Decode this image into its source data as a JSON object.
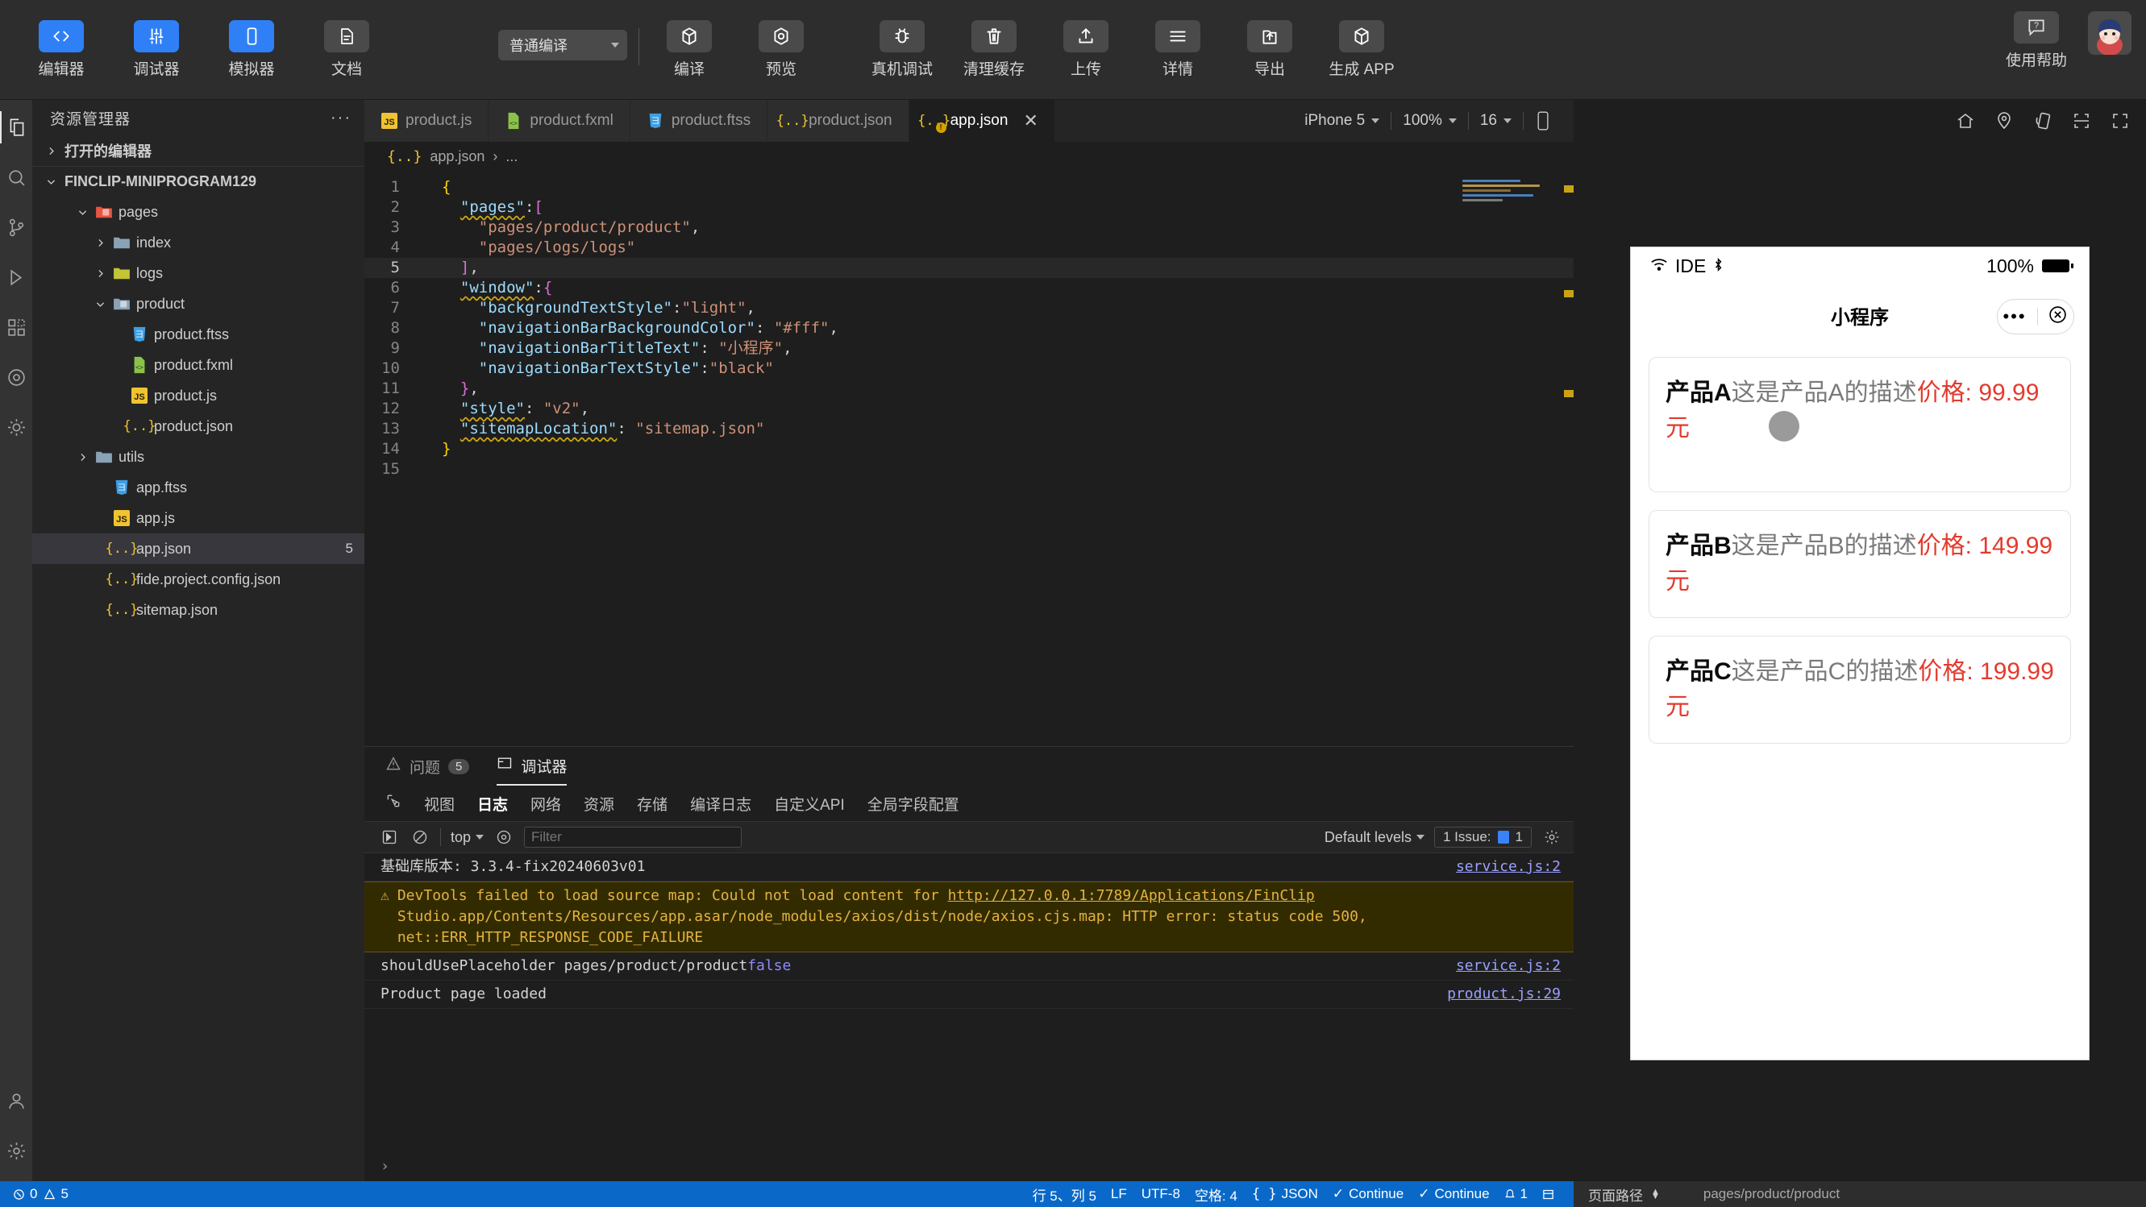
{
  "toolbar": {
    "left_buttons": [
      {
        "label": "编辑器",
        "icon": "code-icon",
        "active": true
      },
      {
        "label": "调试器",
        "icon": "sliders-icon",
        "active": true
      },
      {
        "label": "模拟器",
        "icon": "phone-icon",
        "active": true
      },
      {
        "label": "文档",
        "icon": "document-icon",
        "active": false
      }
    ],
    "compile_mode": "普通编译",
    "center_buttons": [
      {
        "label": "编译",
        "icon": "compile-cube-icon"
      },
      {
        "label": "预览",
        "icon": "preview-eye-icon"
      },
      {
        "label": "真机调试",
        "icon": "bug-icon"
      },
      {
        "label": "清理缓存",
        "icon": "trash-icon"
      },
      {
        "label": "上传",
        "icon": "upload-icon"
      },
      {
        "label": "详情",
        "icon": "hamburger-icon"
      },
      {
        "label": "导出",
        "icon": "export-folder-icon"
      },
      {
        "label": "生成 APP",
        "icon": "generate-cube-icon"
      }
    ],
    "help_label": "使用帮助",
    "help_icon": "question-bubble-icon",
    "avatar": "user-avatar"
  },
  "activitybar": {
    "items": [
      {
        "name": "explorer",
        "icon": "files-icon",
        "selected": true
      },
      {
        "name": "search",
        "icon": "search-icon",
        "selected": false
      },
      {
        "name": "source-control",
        "icon": "branch-icon",
        "selected": false
      },
      {
        "name": "run-debug",
        "icon": "play-debug-icon",
        "selected": false
      },
      {
        "name": "extensions",
        "icon": "extensions-icon",
        "selected": false
      },
      {
        "name": "cloud",
        "icon": "donut-icon",
        "selected": false
      },
      {
        "name": "theme",
        "icon": "sun-icon",
        "selected": false
      },
      {
        "name": "account",
        "icon": "person-icon",
        "selected": false
      },
      {
        "name": "settings",
        "icon": "gear-icon",
        "selected": false
      }
    ]
  },
  "explorer": {
    "title": "资源管理器",
    "more_label": "···",
    "open_editors_label": "打开的编辑器",
    "root_label": "FINCLIP-MINIPROGRAM129",
    "tree": [
      {
        "label": "pages",
        "indent": 1,
        "type": "folder-open",
        "color": "#e8543f",
        "expanded": true,
        "arrow": "down",
        "badge": ""
      },
      {
        "label": "index",
        "indent": 2,
        "type": "folder",
        "color": "#8aa2b5",
        "expanded": false,
        "arrow": "right",
        "badge": ""
      },
      {
        "label": "logs",
        "indent": 2,
        "type": "folder",
        "color": "#c3c436",
        "expanded": false,
        "arrow": "right",
        "badge": ""
      },
      {
        "label": "product",
        "indent": 2,
        "type": "folder-open",
        "color": "#8aa2b5",
        "expanded": true,
        "arrow": "down",
        "badge": ""
      },
      {
        "label": "product.ftss",
        "indent": 3,
        "type": "css",
        "color": "#3c9ee5",
        "arrow": "",
        "badge": ""
      },
      {
        "label": "product.fxml",
        "indent": 3,
        "type": "xml",
        "color": "#8bc34a",
        "arrow": "",
        "badge": ""
      },
      {
        "label": "product.js",
        "indent": 3,
        "type": "js",
        "color": "#f0c330",
        "arrow": "",
        "badge": ""
      },
      {
        "label": "product.json",
        "indent": 3,
        "type": "json",
        "color": "#f0c330",
        "arrow": "",
        "badge": ""
      },
      {
        "label": "utils",
        "indent": 1,
        "type": "folder",
        "color": "#8aa2b5",
        "expanded": false,
        "arrow": "right",
        "badge": ""
      },
      {
        "label": "app.ftss",
        "indent": 2,
        "type": "css",
        "color": "#3c9ee5",
        "arrow": "",
        "badge": ""
      },
      {
        "label": "app.js",
        "indent": 2,
        "type": "js",
        "color": "#f0c330",
        "arrow": "",
        "badge": ""
      },
      {
        "label": "app.json",
        "indent": 2,
        "type": "json",
        "color": "#f0c330",
        "arrow": "",
        "badge": "5",
        "selected": true
      },
      {
        "label": "fide.project.config.json",
        "indent": 2,
        "type": "json",
        "color": "#f0c330",
        "arrow": "",
        "badge": ""
      },
      {
        "label": "sitemap.json",
        "indent": 2,
        "type": "json",
        "color": "#f0c330",
        "arrow": "",
        "badge": ""
      }
    ]
  },
  "editor": {
    "tabs": [
      {
        "label": "product.js",
        "icon": "js",
        "color": "#f0c330",
        "active": false,
        "warn": false
      },
      {
        "label": "product.fxml",
        "icon": "xml",
        "color": "#8bc34a",
        "active": false,
        "warn": false
      },
      {
        "label": "product.ftss",
        "icon": "css",
        "color": "#3c9ee5",
        "active": false,
        "warn": false
      },
      {
        "label": "product.json",
        "icon": "json",
        "color": "#f0c330",
        "active": false,
        "warn": false
      },
      {
        "label": "app.json",
        "icon": "json",
        "color": "#f0c330",
        "active": true,
        "warn": true,
        "close": "✕"
      }
    ],
    "sim_controls": {
      "device": "iPhone 5",
      "zoom": "100%",
      "font_size": "16",
      "rotate_icon": "rotate-device-icon"
    },
    "breadcrumb": {
      "file": "app.json",
      "sep": "›",
      "rest": "..."
    },
    "code_lines": [
      {
        "n": "1",
        "current": false,
        "tokens": [
          {
            "t": "{",
            "c": "k-br1"
          }
        ]
      },
      {
        "n": "2",
        "current": false,
        "tokens": [
          {
            "t": "  ",
            "c": "k-pun"
          },
          {
            "t": "\"pages\"",
            "c": "k-key2"
          },
          {
            "t": ":",
            "c": "k-pun"
          },
          {
            "t": "[",
            "c": "k-br2"
          }
        ]
      },
      {
        "n": "3",
        "current": false,
        "tokens": [
          {
            "t": "    ",
            "c": "k-pun"
          },
          {
            "t": "\"pages/product/product\"",
            "c": "k-str"
          },
          {
            "t": ",",
            "c": "k-pun"
          }
        ]
      },
      {
        "n": "4",
        "current": false,
        "tokens": [
          {
            "t": "    ",
            "c": "k-pun"
          },
          {
            "t": "\"pages/logs/logs\"",
            "c": "k-str"
          }
        ]
      },
      {
        "n": "5",
        "current": true,
        "tokens": [
          {
            "t": "  ",
            "c": "k-pun"
          },
          {
            "t": "]",
            "c": "k-br2"
          },
          {
            "t": ",",
            "c": "k-pun"
          }
        ]
      },
      {
        "n": "6",
        "current": false,
        "tokens": [
          {
            "t": "  ",
            "c": "k-pun"
          },
          {
            "t": "\"window\"",
            "c": "k-key2"
          },
          {
            "t": ":",
            "c": "k-pun"
          },
          {
            "t": "{",
            "c": "k-br2"
          }
        ]
      },
      {
        "n": "7",
        "current": false,
        "tokens": [
          {
            "t": "    ",
            "c": "k-pun"
          },
          {
            "t": "\"backgroundTextStyle\"",
            "c": "k-key"
          },
          {
            "t": ":",
            "c": "k-pun"
          },
          {
            "t": "\"light\"",
            "c": "k-str"
          },
          {
            "t": ",",
            "c": "k-pun"
          }
        ]
      },
      {
        "n": "8",
        "current": false,
        "tokens": [
          {
            "t": "    ",
            "c": "k-pun"
          },
          {
            "t": "\"navigationBarBackgroundColor\"",
            "c": "k-key"
          },
          {
            "t": ": ",
            "c": "k-pun"
          },
          {
            "t": "\"#fff\"",
            "c": "k-str"
          },
          {
            "t": ",",
            "c": "k-pun"
          }
        ]
      },
      {
        "n": "9",
        "current": false,
        "tokens": [
          {
            "t": "    ",
            "c": "k-pun"
          },
          {
            "t": "\"navigationBarTitleText\"",
            "c": "k-key"
          },
          {
            "t": ": ",
            "c": "k-pun"
          },
          {
            "t": "\"小程序\"",
            "c": "k-str"
          },
          {
            "t": ",",
            "c": "k-pun"
          }
        ]
      },
      {
        "n": "10",
        "current": false,
        "tokens": [
          {
            "t": "    ",
            "c": "k-pun"
          },
          {
            "t": "\"navigationBarTextStyle\"",
            "c": "k-key"
          },
          {
            "t": ":",
            "c": "k-pun"
          },
          {
            "t": "\"black\"",
            "c": "k-str"
          }
        ]
      },
      {
        "n": "11",
        "current": false,
        "tokens": [
          {
            "t": "  ",
            "c": "k-pun"
          },
          {
            "t": "}",
            "c": "k-br2"
          },
          {
            "t": ",",
            "c": "k-pun"
          }
        ]
      },
      {
        "n": "12",
        "current": false,
        "tokens": [
          {
            "t": "  ",
            "c": "k-pun"
          },
          {
            "t": "\"style\"",
            "c": "k-key2"
          },
          {
            "t": ": ",
            "c": "k-pun"
          },
          {
            "t": "\"v2\"",
            "c": "k-str"
          },
          {
            "t": ",",
            "c": "k-pun"
          }
        ]
      },
      {
        "n": "13",
        "current": false,
        "tokens": [
          {
            "t": "  ",
            "c": "k-pun"
          },
          {
            "t": "\"sitemapLocation\"",
            "c": "k-key2"
          },
          {
            "t": ": ",
            "c": "k-pun"
          },
          {
            "t": "\"sitemap.json\"",
            "c": "k-str"
          }
        ]
      },
      {
        "n": "14",
        "current": false,
        "tokens": [
          {
            "t": "}",
            "c": "k-br1"
          }
        ]
      },
      {
        "n": "15",
        "current": false,
        "tokens": []
      }
    ]
  },
  "panel": {
    "tabs": [
      {
        "label": "问题",
        "icon": "warning-triangle-icon",
        "badge": "5",
        "active": false
      },
      {
        "label": "调试器",
        "icon": "panel-icon",
        "badge": "",
        "active": true
      }
    ],
    "debug_tabs": [
      {
        "label": "视图",
        "active": false
      },
      {
        "label": "日志",
        "active": true
      },
      {
        "label": "网络",
        "active": false
      },
      {
        "label": "资源",
        "active": false
      },
      {
        "label": "存储",
        "active": false
      },
      {
        "label": "编译日志",
        "active": false
      },
      {
        "label": "自定义API",
        "active": false
      },
      {
        "label": "全局字段配置",
        "active": false
      }
    ],
    "console_toolbar": {
      "inspect_icon": "inspect-icon",
      "clear_icon": "clear-console-icon",
      "context": "top",
      "eye_icon": "eye-icon",
      "filter_placeholder": "Filter",
      "levels": "Default levels",
      "issues_label": "1 Issue:",
      "issues_count": "1",
      "settings_icon": "gear-icon"
    },
    "console_rows": [
      {
        "type": "info",
        "text": "基础库版本: 3.3.4-fix20240603v01",
        "source": "service.js:2"
      },
      {
        "type": "warn",
        "prefix": "DevTools failed to load source map: Could not load content for ",
        "link": "http://127.0.0.1:7789/Applications/FinClip",
        "rest": "Studio.app/Contents/Resources/app.asar/node_modules/axios/dist/node/axios.cjs.map: HTTP error: status code 500, net::ERR_HTTP_RESPONSE_CODE_FAILURE",
        "source": ""
      },
      {
        "type": "log",
        "text": "shouldUsePlaceholder pages/product/product ",
        "value": "false",
        "source": "service.js:2"
      },
      {
        "type": "log",
        "text": "Product page loaded",
        "value": "",
        "source": "product.js:29"
      }
    ],
    "prompt": "›"
  },
  "simulator": {
    "top_icons": [
      "home-icon",
      "location-pin-icon",
      "rotate-device-icon",
      "scan-icon",
      "expand-icon"
    ],
    "status": {
      "wifi_icon": "wifi-icon",
      "carrier": "IDE",
      "bluetooth_icon": "bluetooth-icon",
      "battery_pct": "100%",
      "battery_icon": "battery-icon"
    },
    "nav_title": "小程序",
    "capsule": {
      "more": "•••",
      "close_icon": "close-circle-icon"
    },
    "products": [
      {
        "name": "产品A",
        "desc": "这是产品A的描述",
        "price_label": "价格: ",
        "price": "99.99",
        "unit": "元",
        "has_image": true
      },
      {
        "name": "产品B",
        "desc": "这是产品B的描述",
        "price_label": "价格: ",
        "price": "149.99",
        "unit": "元",
        "has_image": false
      },
      {
        "name": "产品C",
        "desc": "这是产品C的描述",
        "price_label": "价格: ",
        "price": "199.99",
        "unit": "元",
        "has_image": false
      }
    ]
  },
  "statusbar": {
    "errors": "0",
    "warnings": "5",
    "position": "行 5、列 5",
    "eol": "LF",
    "encoding": "UTF-8",
    "indent": "空格: 4",
    "language": "JSON",
    "continue1": "Continue",
    "continue2": "Continue",
    "bell_count": "1",
    "page_path_label": "页面路径",
    "page_path_value": "pages/product/product"
  },
  "colors": {
    "accent_blue": "#2f80f7",
    "statusbar_blue": "#0a69c8",
    "warn_yellow": "#e2b341",
    "price_red": "#e33b2e"
  }
}
